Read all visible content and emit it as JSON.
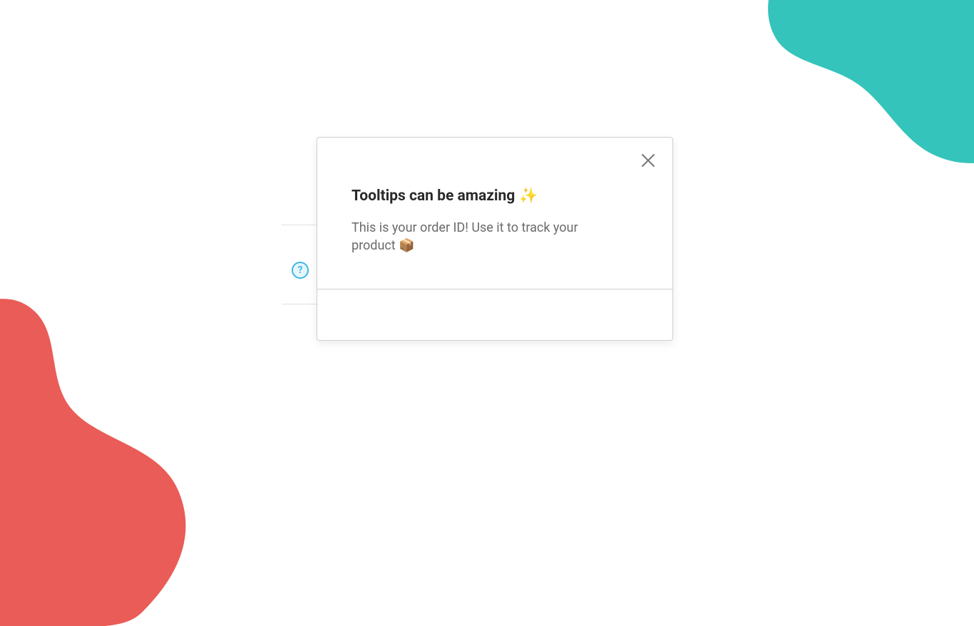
{
  "decor": {
    "teal": "#34c4bb",
    "red": "#ea5c57"
  },
  "help": {
    "glyph": "?"
  },
  "tooltip": {
    "title": "Tooltips can be amazing",
    "title_emoji": "✨",
    "description": "This is your order ID! Use it to track your product 📦",
    "close_label": "Close"
  }
}
